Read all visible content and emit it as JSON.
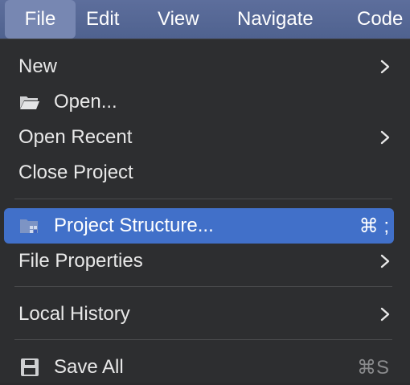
{
  "menubar": {
    "items": [
      {
        "label": "File"
      },
      {
        "label": "Edit"
      },
      {
        "label": "View"
      },
      {
        "label": "Navigate"
      },
      {
        "label": "Code"
      }
    ]
  },
  "file_menu": {
    "items": [
      {
        "label": "New",
        "submenu": true
      },
      {
        "label": "Open...",
        "icon": "folder-open-icon"
      },
      {
        "label": "Open Recent",
        "submenu": true
      },
      {
        "label": "Close Project"
      },
      {
        "label": "Project Structure...",
        "icon": "project-structure-icon",
        "shortcut": "⌘ ;",
        "highlighted": true
      },
      {
        "label": "File Properties",
        "submenu": true
      },
      {
        "label": "Local History",
        "submenu": true
      },
      {
        "label": "Save All",
        "icon": "save-icon",
        "shortcut": "⌘S"
      }
    ]
  },
  "colors": {
    "menubar_bg": "#55679a",
    "highlight": "#4170c9",
    "menu_bg": "#2d2e30"
  }
}
